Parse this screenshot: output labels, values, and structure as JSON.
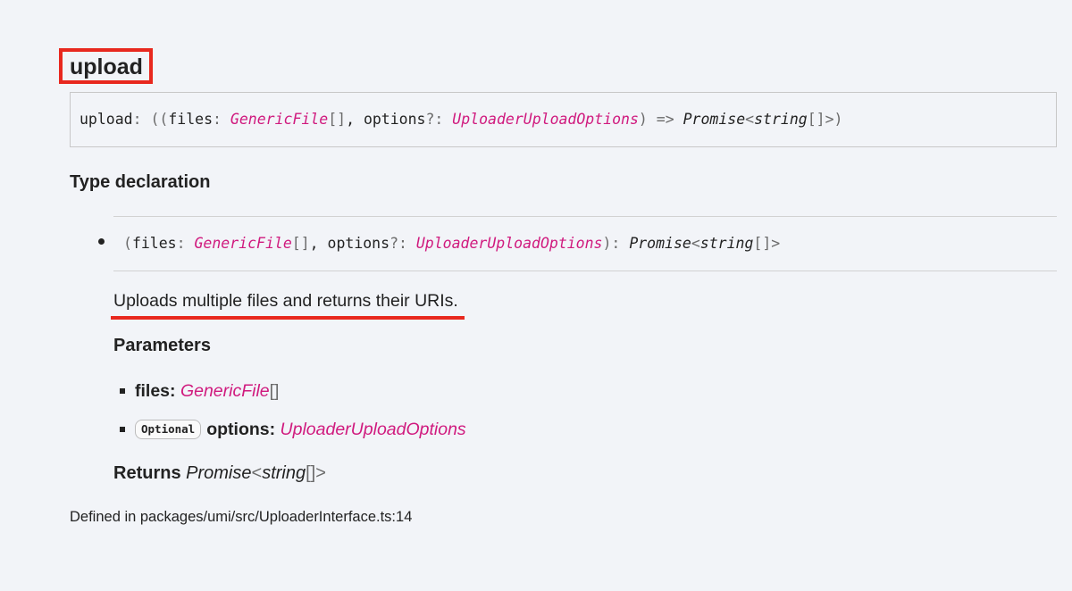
{
  "member": {
    "title": "upload"
  },
  "signature": {
    "name": "upload",
    "colon": ": ",
    "open": "((",
    "param1_name": "files",
    "param_colon": ": ",
    "param1_type": "GenericFile",
    "array": "[]",
    "comma": ", ",
    "param2_name": "options",
    "optional_colon": "?: ",
    "param2_type": "UploaderUploadOptions",
    "close": ")",
    "arrow": " => ",
    "return_type": "Promise",
    "generic_open": "<",
    "return_inner": "string",
    "generic_close": ">",
    "end": ")"
  },
  "type_declaration": {
    "heading": "Type declaration",
    "call_signature": {
      "open": "(",
      "param1_name": "files",
      "param_colon": ": ",
      "param1_type": "GenericFile",
      "array": "[]",
      "comma": ", ",
      "param2_name": "options",
      "optional_colon": "?: ",
      "param2_type": "UploaderUploadOptions",
      "close": "): ",
      "return_type": "Promise",
      "generic_open": "<",
      "return_inner": "string",
      "generic_close": ">"
    },
    "description": "Uploads multiple files and returns their URIs.",
    "parameters_heading": "Parameters",
    "parameters": [
      {
        "name": "files:",
        "type": "GenericFile",
        "suffix": "[]"
      },
      {
        "flag": "Optional",
        "name": "options:",
        "type": "UploaderUploadOptions"
      }
    ],
    "returns_label": "Returns",
    "returns_type": "Promise",
    "returns_generic_open": "<",
    "returns_inner": "string",
    "returns_array": "[]",
    "returns_generic_close": ">"
  },
  "defined_in": "Defined in packages/umi/src/UploaderInterface.ts:14",
  "colors": {
    "background": "#f2f4f8",
    "type_link": "#d01a7e",
    "annotation": "#e8281e",
    "text": "#222222",
    "punctuation": "#6b6b6b"
  }
}
